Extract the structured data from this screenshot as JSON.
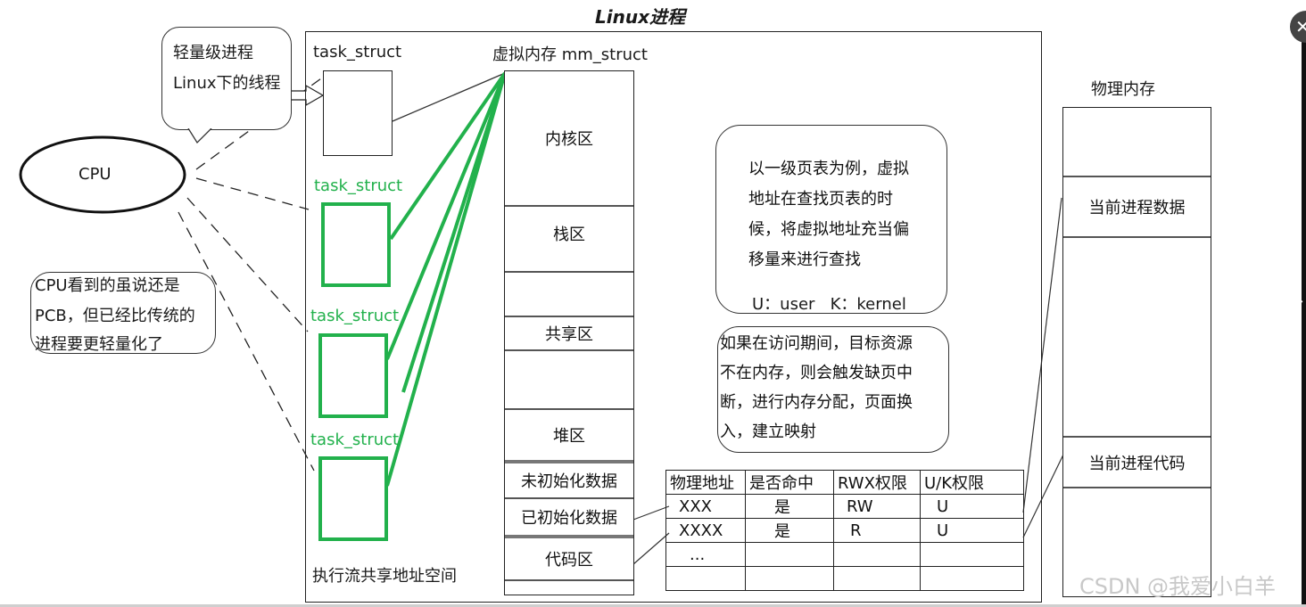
{
  "title": "Linux进程",
  "bubble_thread": {
    "line1": "轻量级进程",
    "line2": "Linux下的线程"
  },
  "cpu_label": "CPU",
  "cpu_note": {
    "line1": "CPU看到的虽说还是",
    "line2": "PCB，但已经比传统的",
    "line3": "进程要更轻量化了"
  },
  "process_box": {
    "task_struct_labels": [
      "task_struct",
      "task_struct",
      "task_struct",
      "task_struct"
    ],
    "mm_struct_label": "虚拟内存 mm_struct",
    "footer": "执行流共享地址空间",
    "regions": [
      "内核区",
      "栈区",
      "共享区",
      "堆区",
      "未初始化数据",
      "已初始化数据",
      "代码区"
    ]
  },
  "page_table_note": {
    "lines": [
      "以一级页表为例，虚拟",
      "地址在查找页表的时",
      "候，将虚拟地址充当偏",
      "移量来进行查找"
    ],
    "legend": "U：user   K：kernel"
  },
  "page_fault_note": {
    "lines": [
      "如果在访问期间，目标资源",
      "不在内存，则会触发缺页中",
      "断，进行内存分配，页面换",
      "入，建立映射"
    ]
  },
  "page_table": {
    "headers": [
      "物理地址",
      "是否命中",
      "RWX权限",
      "U/K权限"
    ],
    "rows": [
      [
        "XXX",
        "是",
        "RW",
        "U"
      ],
      [
        "XXXX",
        "是",
        "R",
        "U"
      ],
      [
        "...",
        "",
        "",
        ""
      ],
      [
        "",
        "",
        "",
        ""
      ]
    ]
  },
  "physical_memory": {
    "label": "物理内存",
    "blocks": [
      "",
      "当前进程数据",
      "",
      "当前进程代码",
      ""
    ]
  },
  "watermark": "CSDN @我爱小白羊",
  "viewer": {
    "close_icon": "✕",
    "next_icon": "›"
  },
  "colors": {
    "thread_green": "#22b14c",
    "line": "#222222"
  }
}
